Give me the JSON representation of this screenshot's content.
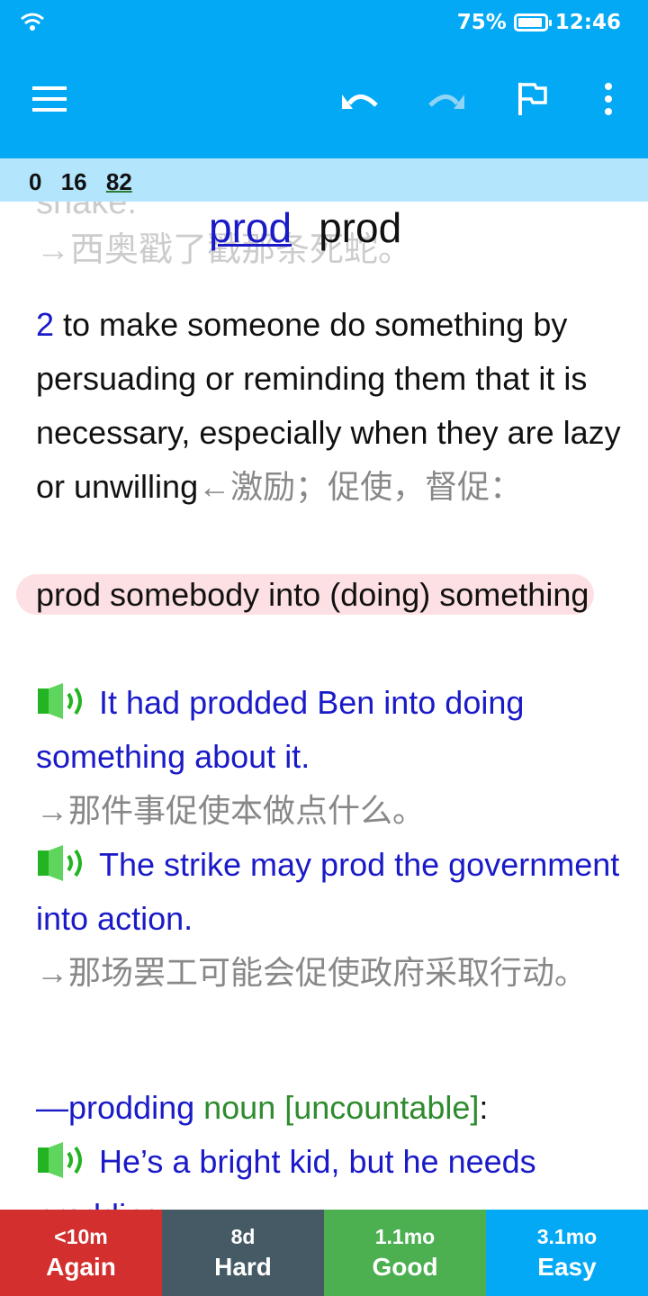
{
  "status_bar": {
    "battery": "75%",
    "battery_level": 0.75,
    "time": "12:46"
  },
  "toolbar": {
    "menu_icon": "hamburger-menu-icon",
    "undo_icon": "undo-icon",
    "redo_icon": "redo-icon",
    "flag_icon": "flag-icon",
    "more_icon": "more-vert-icon"
  },
  "counts": {
    "new": "0",
    "learning": "16",
    "review": "82"
  },
  "card": {
    "faded_top": "snake.",
    "faded_translation": "→西奥戳了戳那条死蛇。",
    "headword": "prod",
    "headword_plain": "prod",
    "sense_number": "2",
    "definition": " to make someone do something by persuading or reminding them that it is necessary, especially when they are lazy or unwilling",
    "definition_zh": "←激励；促使，督促：",
    "pattern": "prod somebody into (doing) something",
    "examples": [
      {
        "en": "It had prodded Ben into doing something about it.",
        "zh": "→那件事促使本做点什么。"
      },
      {
        "en": "The strike may prod the government into action.",
        "zh": "→那场罢工可能会促使政府采取行动。"
      }
    ],
    "derivative": "—prodding",
    "derivative_grammar": " noun [uncountable]",
    "derivative_colon": ":",
    "example3": "He’s a bright kid, but he needs prodding."
  },
  "answer_buttons": [
    {
      "interval": "<10m",
      "label": "Again",
      "color": "#d32f2f"
    },
    {
      "interval": "8d",
      "label": "Hard",
      "color": "#455a64"
    },
    {
      "interval": "1.1mo",
      "label": "Good",
      "color": "#4caf50"
    },
    {
      "interval": "3.1mo",
      "label": "Easy",
      "color": "#03a9f4"
    }
  ]
}
